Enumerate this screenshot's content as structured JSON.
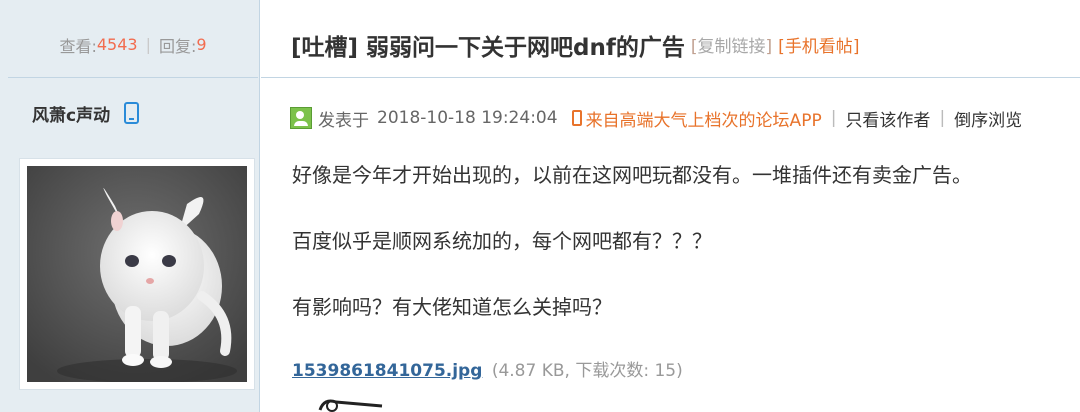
{
  "stats": {
    "views_label": "查看:",
    "views": "4543",
    "replies_label": "回复:",
    "replies": "9"
  },
  "thread": {
    "tag": "[吐槽]",
    "title": "弱弱问一下关于网吧dnf的广告",
    "copy_link": "复制链接",
    "mobile_view": "手机看帖"
  },
  "author": {
    "name": "风萧c声动",
    "avatar_icon": "kitten-avatar",
    "device_icon": "phone-icon"
  },
  "post": {
    "posted_label": "发表于",
    "datetime": "2018-10-18 19:24:04",
    "source": "来自高端大气上档次的论坛APP",
    "only_author": "只看该作者",
    "reverse_order": "倒序浏览",
    "lines": [
      "好像是今年才开始出现的，以前在这网吧玩都没有。一堆插件还有卖金广告。",
      "百度似乎是顺网系统加的，每个网吧都有？？？",
      "有影响吗？有大佬知道怎么关掉吗？"
    ]
  },
  "attachment": {
    "filename": "1539861841075.jpg",
    "meta": "(4.87 KB, 下载次数: 15)"
  },
  "colors": {
    "sidebar_bg": "#e5edf2",
    "border": "#c2d5e3",
    "accent_orange": "#f26c4f",
    "link_blue": "#336699"
  }
}
